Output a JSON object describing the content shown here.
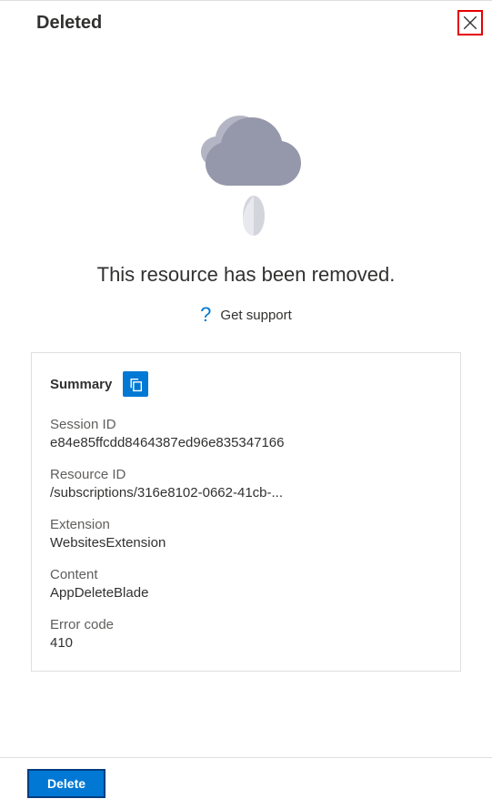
{
  "header": {
    "title": "Deleted"
  },
  "message": "This resource has been removed.",
  "support": {
    "link_text": "Get support"
  },
  "summary": {
    "title": "Summary",
    "fields": {
      "session_id": {
        "label": "Session ID",
        "value": "e84e85ffcdd8464387ed96e835347166"
      },
      "resource_id": {
        "label": "Resource ID",
        "value": "/subscriptions/316e8102-0662-41cb-..."
      },
      "extension": {
        "label": "Extension",
        "value": "WebsitesExtension"
      },
      "content": {
        "label": "Content",
        "value": "AppDeleteBlade"
      },
      "error_code": {
        "label": "Error code",
        "value": "410"
      }
    }
  },
  "footer": {
    "delete_label": "Delete"
  }
}
